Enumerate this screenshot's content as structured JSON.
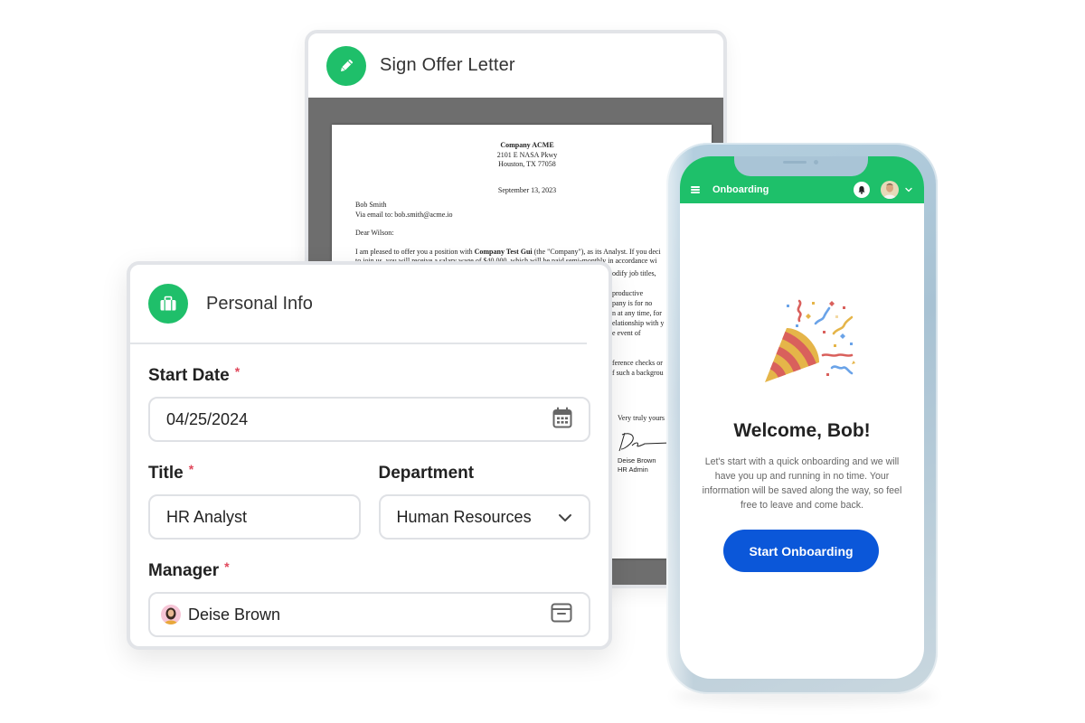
{
  "offer_letter": {
    "title": "Sign Offer Letter",
    "icon": "pencil-icon",
    "document": {
      "company": "Company ACME",
      "address_line1": "2101 E NASA Pkwy",
      "address_line2": "Houston, TX 77058",
      "date": "September 13, 2023",
      "recipient_name": "Bob Smith",
      "recipient_email_line": "Via email to: bob.smith@acme.io",
      "salutation": "Dear Wilson:",
      "para1_prefix": "I am pleased to offer you a position with ",
      "para1_company": "Company Test Gui",
      "para1_suffix": " (the \"Company\"), as its Analyst. If you deci",
      "para1_line2": "to join us, you will receive a salary wage of $40,000, which will be paid semi-monthly in accordance wi",
      "fragments": [
        "odify job titles,",
        "",
        "productive",
        "pany is for no",
        "n at any time, for",
        "elationship with y",
        "e event of",
        "",
        "",
        "ference checks or",
        "f such a backgrou"
      ],
      "closing": "Very truly yours",
      "signer_name": "Deise Brown",
      "signer_title": "HR Admin"
    }
  },
  "personal_info": {
    "title": "Personal Info",
    "icon": "briefcase-icon",
    "fields": {
      "start_date": {
        "label": "Start Date",
        "required_mark": "*",
        "value": "04/25/2024"
      },
      "title": {
        "label": "Title",
        "required_mark": "*",
        "value": "HR Analyst"
      },
      "department": {
        "label": "Department",
        "value": "Human Resources"
      },
      "manager": {
        "label": "Manager",
        "required_mark": "*",
        "value": "Deise Brown"
      }
    }
  },
  "phone_app": {
    "app_title": "Onboarding",
    "welcome_title": "Welcome, Bob!",
    "welcome_body": "Let's start with a quick onboarding and we will have you up and running in no time. Your information will be saved along the way, so feel free to leave and come back.",
    "cta_label": "Start Onboarding"
  },
  "colors": {
    "brand_green": "#1ec06a",
    "primary_blue": "#0b57d9",
    "required_red": "#e0475b"
  }
}
